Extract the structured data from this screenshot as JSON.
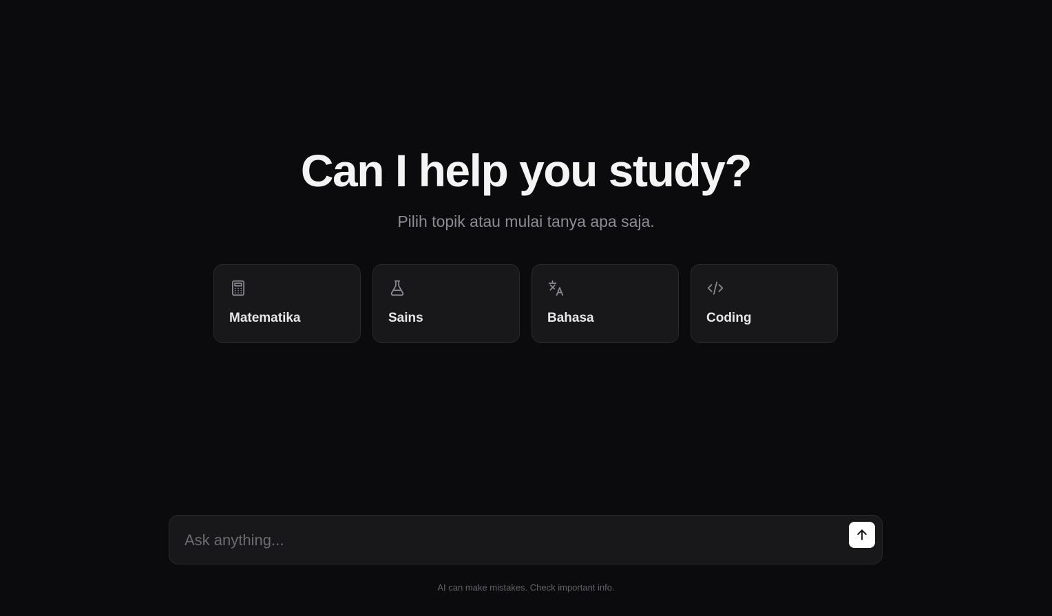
{
  "hero": {
    "title": "Can I help you study?",
    "subtitle": "Pilih topik atau mulai tanya apa saja."
  },
  "topics": [
    {
      "label": "Matematika",
      "icon": "calculator-icon"
    },
    {
      "label": "Sains",
      "icon": "flask-icon"
    },
    {
      "label": "Bahasa",
      "icon": "translate-icon"
    },
    {
      "label": "Coding",
      "icon": "code-icon"
    }
  ],
  "chat": {
    "placeholder": "Ask anything...",
    "value": "",
    "send_icon": "arrow-up-icon"
  },
  "footer": {
    "disclaimer": "AI can make mistakes. Check important info."
  },
  "colors": {
    "background": "#0b0b0d",
    "card": "#18181b",
    "border": "#2a2a2e",
    "title": "#f4f4f5",
    "subtitle": "#8c8c94",
    "send_button": "#ffffff"
  }
}
